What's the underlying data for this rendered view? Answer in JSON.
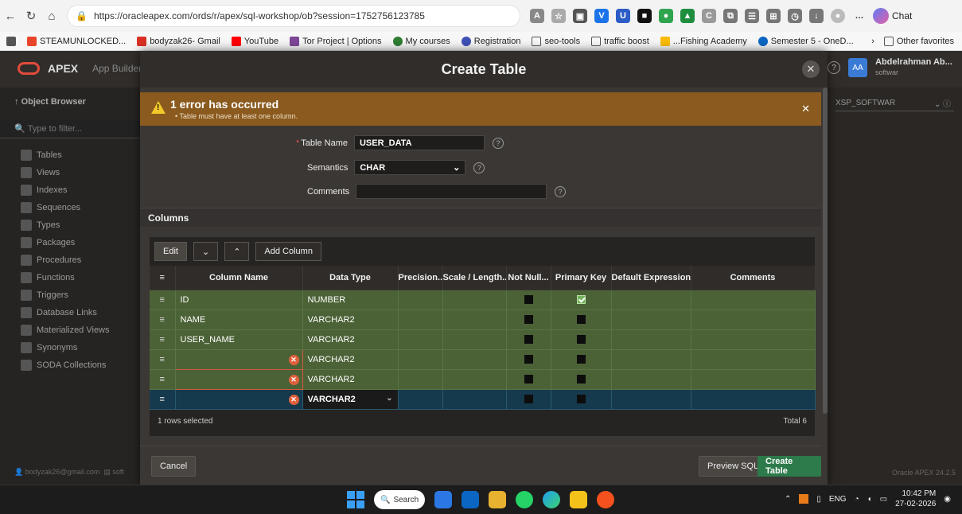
{
  "browser": {
    "url": "https://oracleapex.com/ords/r/apex/sql-workshop/ob?session=1752756123785",
    "chat_label": "Chat",
    "favorites": [
      "STEAMUNLOCKED...",
      "bodyzak26- Gmail",
      "YouTube",
      "Tor Project | Options",
      "My courses",
      "Registration",
      "seo-tools",
      "traffic boost",
      "...Fishing Academy",
      "Semester 5 - OneD..."
    ],
    "other_favorites": "Other favorites"
  },
  "apex": {
    "brand": "APEX",
    "app_builder": "App Builder",
    "user_initials": "AA",
    "user_name": "Abdelrahman Ab...",
    "user_sub": "softwar",
    "schema": "XSP_SOFTWAR",
    "version": "Oracle APEX 24.2.5",
    "sidebar": {
      "header": "Object Browser",
      "filter_placeholder": "Type to filter...",
      "items": [
        "Tables",
        "Views",
        "Indexes",
        "Sequences",
        "Types",
        "Packages",
        "Procedures",
        "Functions",
        "Triggers",
        "Database Links",
        "Materialized Views",
        "Synonyms",
        "SODA Collections"
      ],
      "footer_email": "bodyzak26@gmail.com",
      "footer_extra": "soft"
    }
  },
  "dialog": {
    "title": "Create Table",
    "error_title": "1 error has occurred",
    "error_msg": "• Table must have at least one column.",
    "table_name_label": "Table Name",
    "table_name_value": "USER_DATA",
    "semantics_label": "Semantics",
    "semantics_value": "CHAR",
    "comments_label": "Comments",
    "comments_value": "",
    "columns_section": "Columns",
    "toolbar": {
      "edit": "Edit",
      "add_column": "Add Column"
    },
    "headers": [
      "Column Name",
      "Data Type",
      "Precision..",
      "Scale / Length..",
      "Not Null...",
      "Primary Key",
      "Default Expression..",
      "Comments"
    ],
    "rows": [
      {
        "name": "ID",
        "type": "NUMBER",
        "not_null": false,
        "pk": true
      },
      {
        "name": "NAME",
        "type": "VARCHAR2",
        "not_null": false,
        "pk": false
      },
      {
        "name": "USER_NAME",
        "type": "VARCHAR2",
        "not_null": false,
        "pk": false
      },
      {
        "name": "",
        "type": "VARCHAR2",
        "not_null": false,
        "pk": false
      },
      {
        "name": "",
        "type": "VARCHAR2",
        "not_null": false,
        "pk": false
      },
      {
        "name": "",
        "type": "VARCHAR2",
        "not_null": false,
        "pk": false
      }
    ],
    "selected_text": "1 rows selected",
    "total_text": "Total 6",
    "cancel": "Cancel",
    "preview_sql": "Preview SQL",
    "create_table": "Create Table"
  },
  "taskbar": {
    "search": "Search",
    "lang": "ENG",
    "time": "10:42 PM",
    "date": "27-02-2026"
  }
}
